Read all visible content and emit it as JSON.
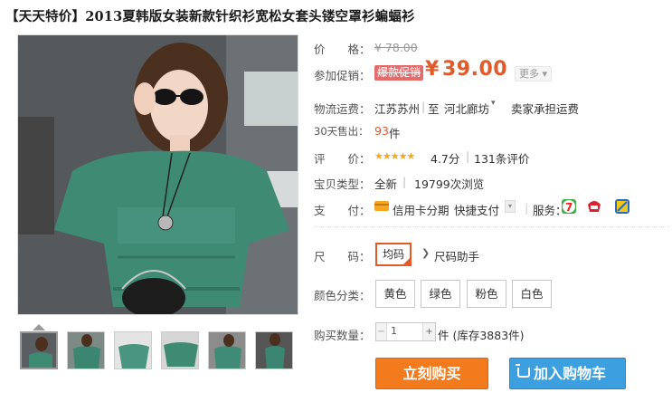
{
  "title": "【天天特价】2013夏韩版女装新款针织衫宽松女套头镂空罩衫蝙蝠衫",
  "price_row": {
    "label": "价　　格：",
    "old_price": "¥ 78.00"
  },
  "promo_row": {
    "label": "参加促销：",
    "tag": "爆款促销",
    "yen": "¥",
    "price": "39.00",
    "more": "更多 ▾"
  },
  "logistics": {
    "label": "物流运费：",
    "from": "江苏苏州",
    "to_label": "至",
    "to": "河北廊坊",
    "fee": "卖家承担运费"
  },
  "sales": {
    "label": "30天售出：",
    "count": "93",
    "unit": "件"
  },
  "rating": {
    "label": "评　　价：",
    "stars": "★★★★★",
    "score": "4.7分",
    "reviews": "131条评价",
    "score_value": 4.7
  },
  "item_type": {
    "label": "宝贝类型：",
    "condition": "全新",
    "views": "19799次浏览"
  },
  "payment": {
    "label": "支　　付：",
    "method1": "信用卡分期",
    "method2": "快捷支付",
    "services_label": "服务："
  },
  "size": {
    "label": "尺　　码：",
    "selected": "均码",
    "helper": "尺码助手"
  },
  "color": {
    "label": "颜色分类：",
    "options": [
      "黄色",
      "绿色",
      "粉色",
      "白色"
    ]
  },
  "quantity": {
    "label": "购买数量：",
    "value": "1",
    "stock": "件 (库存3883件)"
  },
  "buttons": {
    "buy_now": "立刻购买",
    "add_to_cart": "加入购物车"
  },
  "colors": {
    "accent": "#e25a2a",
    "buy": "#f37b1d",
    "cart": "#3c9fe0"
  }
}
